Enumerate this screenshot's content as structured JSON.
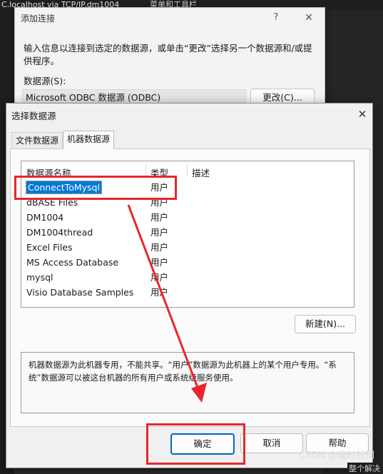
{
  "background": {
    "title_left": "C.localhost via TCP/IP.dm1004",
    "title_right": "菜单和工具栏",
    "corner_text": "整个解决"
  },
  "add_connection": {
    "title": "添加连接",
    "help_glyph": "?",
    "close_glyph": "✕",
    "info_text": "输入信息以连接到选定的数据源，或单击“更改”选择另一个数据源和/或提供程序。",
    "datasource_label": "数据源(S):",
    "datasource_value": "Microsoft ODBC 数据源 (ODBC)",
    "change_button": "更改(C)..."
  },
  "select_datasource": {
    "title": "选择数据源",
    "close_glyph": "✕",
    "tabs": [
      {
        "label": "文件数据源"
      },
      {
        "label": "机器数据源"
      }
    ],
    "columns": {
      "name": "数据源名称",
      "type": "类型",
      "desc": "描述"
    },
    "rows": [
      {
        "name": "ConnectToMysql",
        "type": "用户"
      },
      {
        "name": "dBASE Files",
        "type": "用户"
      },
      {
        "name": "DM1004",
        "type": "用户"
      },
      {
        "name": "DM1004thread",
        "type": "用户"
      },
      {
        "name": "Excel Files",
        "type": "用户"
      },
      {
        "name": "MS Access Database",
        "type": "用户"
      },
      {
        "name": "mysql",
        "type": "用户"
      },
      {
        "name": "Visio Database Samples",
        "type": "用户"
      }
    ],
    "selected_row": "ConnectToMysql",
    "new_button": "新建(N)...",
    "description": "机器数据源为此机器专用，不能共享。“用户”数据源为此机器上的某个用户专用。“系统”数据源可以被这台机器的所有用户或系统级服务使用。",
    "ok_button": "确定",
    "cancel_button": "取消",
    "help_button": "帮助"
  },
  "watermark": "CSDN @唐时领词",
  "colors": {
    "accent": "#0078d7",
    "annotation_red": "#e8262b"
  }
}
